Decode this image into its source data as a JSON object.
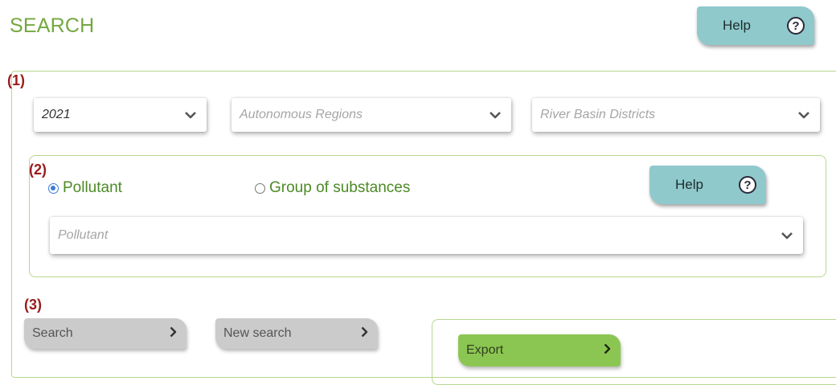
{
  "header": {
    "title": "SEARCH",
    "help_label": "Help",
    "help_icon": "question-circle-icon"
  },
  "section1": {
    "marker": "(1)",
    "year_select": {
      "value": "2021"
    },
    "region_select": {
      "placeholder": "Autonomous Regions"
    },
    "basin_select": {
      "placeholder": "River Basin Districts"
    }
  },
  "section2": {
    "marker": "(2)",
    "radio_pollutant_label": "Pollutant",
    "radio_pollutant_selected": true,
    "radio_group_label": "Group of substances",
    "radio_group_selected": false,
    "help_label": "Help",
    "pollutant_select": {
      "placeholder": "Pollutant"
    }
  },
  "section3": {
    "marker": "(3)",
    "search_label": "Search",
    "new_search_label": "New search",
    "export_label": "Export"
  },
  "colors": {
    "accent_green": "#74a83f",
    "help_teal": "#8fc9cc",
    "export_green": "#8cc652",
    "marker_red": "#9b1b1b"
  }
}
